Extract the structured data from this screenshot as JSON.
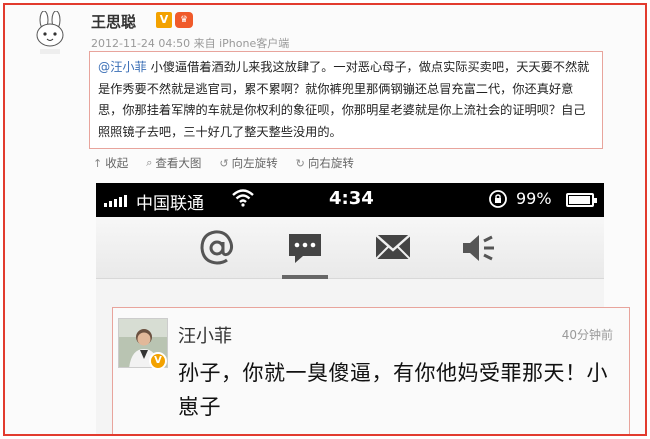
{
  "post": {
    "author": "王思聪",
    "verified_badge": "V",
    "meta": "2012-11-24 04:50  来自 iPhone客户端",
    "quote": {
      "mention": "@汪小菲",
      "text": " 小傻逼借着酒劲儿来我这放肆了。一对恶心母子，做点实际买卖吧，天天要不然就是作秀要不然就是逃官司，累不累啊？就你裤兜里那俩钢镚还总冒充富二代，你还真好意思，你那挂着军牌的车就是你权利的象征呗，你那明星老婆就是你上流社会的证明呗？自己照照镜子去吧，三十好几了整天整些没用的。"
    },
    "toolbar": {
      "collapse": "收起",
      "view_large": "查看大图",
      "rotate_left": "向左旋转",
      "rotate_right": "向右旋转"
    }
  },
  "phone": {
    "carrier": "中国联通",
    "time": "4:34",
    "battery": "99%",
    "tabs": [
      "at-mention-icon",
      "comment-bubble-icon",
      "mail-icon",
      "speaker-icon"
    ]
  },
  "message": {
    "name": "汪小菲",
    "time": "40分钟前",
    "text": "孙子，你就一臭傻逼，有你他妈受罪那天！小崽子"
  },
  "colors": {
    "frame_border": "#e23b2e",
    "mention": "#3b6fb6",
    "badge_orange": "#f3a200"
  }
}
